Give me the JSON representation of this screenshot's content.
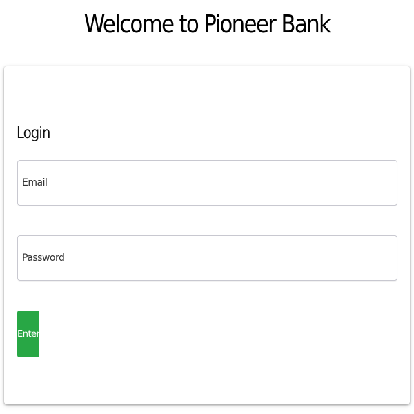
{
  "header": {
    "title": "Welcome to Pioneer Bank"
  },
  "login_form": {
    "heading": "Login",
    "email_placeholder": "Email",
    "email_value": "",
    "password_placeholder": "Password",
    "password_value": "",
    "enter_label": "Enter"
  },
  "colors": {
    "enter_button": "#28a745",
    "background": "#ffffff"
  }
}
